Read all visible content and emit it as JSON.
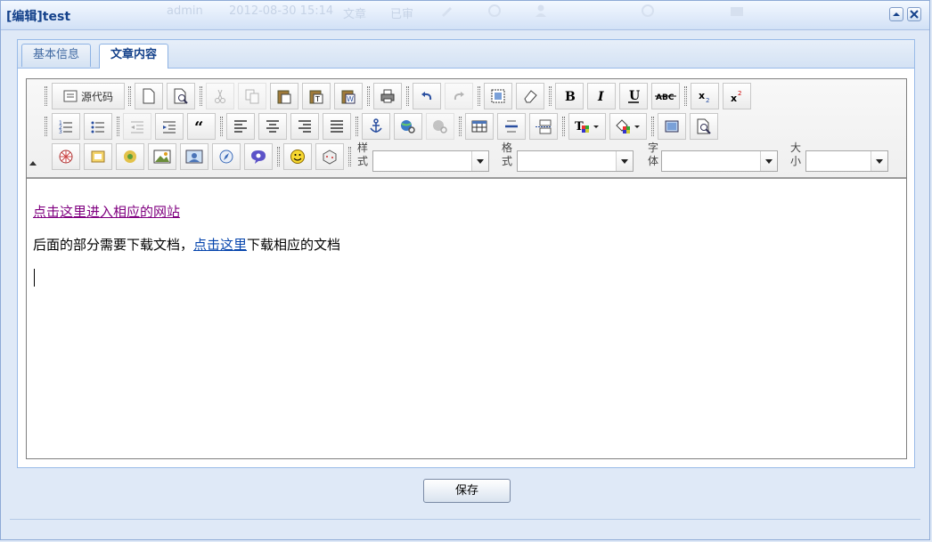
{
  "window": {
    "title": "[编辑]test"
  },
  "background_row": {
    "user": "admin",
    "datetime": "2012-08-30 15:14",
    "type": "文章",
    "status": "已审"
  },
  "tabs": [
    {
      "label": "基本信息",
      "active": false
    },
    {
      "label": "文章内容",
      "active": true
    }
  ],
  "toolbar": {
    "source_label": "源代码",
    "combos": [
      {
        "label": "样式",
        "value": ""
      },
      {
        "label": "格式",
        "value": ""
      },
      {
        "label": "字体",
        "value": ""
      },
      {
        "label": "大小",
        "value": ""
      }
    ]
  },
  "content": {
    "line1_link": "点击这里进入相应的网站",
    "line2_before": "后面的部分需要下载文档，",
    "line2_link": "点击这里",
    "line2_after": "下载相应的文档"
  },
  "footer": {
    "save_label": "保存"
  },
  "colors": {
    "title": "#15428b",
    "visited_link": "#800080",
    "link": "#0645ad",
    "border": "#99bbe8"
  }
}
